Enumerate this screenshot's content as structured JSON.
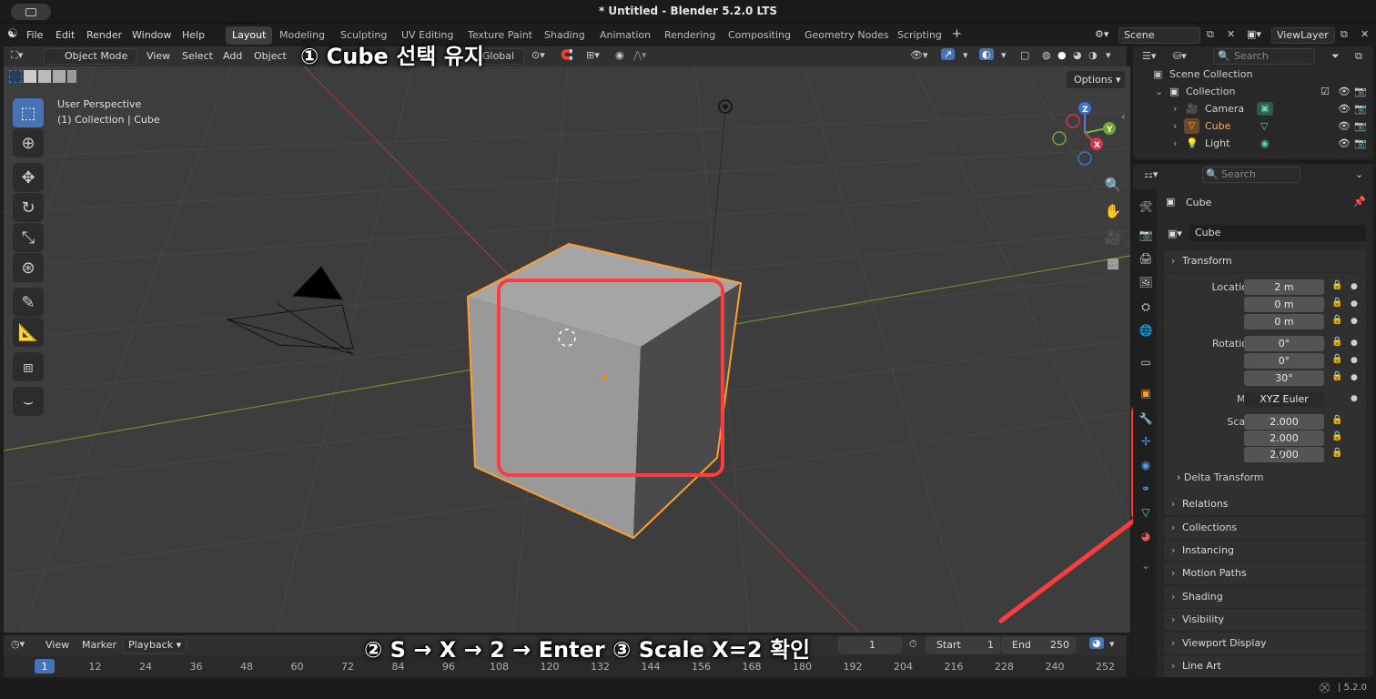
{
  "window": {
    "title": "* Untitled - Blender 5.2.0 LTS"
  },
  "menu": [
    "File",
    "Edit",
    "Render",
    "Window",
    "Help"
  ],
  "workspaces": [
    {
      "label": "Layout",
      "active": true
    },
    {
      "label": "Modeling"
    },
    {
      "label": "Sculpting"
    },
    {
      "label": "UV Editing"
    },
    {
      "label": "Texture Paint"
    },
    {
      "label": "Shading"
    },
    {
      "label": "Animation"
    },
    {
      "label": "Rendering"
    },
    {
      "label": "Compositing"
    },
    {
      "label": "Geometry Nodes"
    },
    {
      "label": "Scripting"
    }
  ],
  "scene": {
    "name": "Scene",
    "view_layer": "ViewLayer"
  },
  "viewport": {
    "mode": "Object Mode",
    "menus": [
      "View",
      "Select",
      "Add",
      "Object"
    ],
    "transform_orientation": "Global",
    "options_label": "Options",
    "perspective_label": "User Perspective",
    "context_label": "(1) Collection | Cube"
  },
  "gizmo": {
    "x": "X",
    "y": "Y",
    "z": "Z"
  },
  "timeline": {
    "menus": [
      "View",
      "Marker"
    ],
    "playback": "Playback",
    "current_frame": "1",
    "start_label": "Start",
    "start": "1",
    "end_label": "End",
    "end": "250",
    "ticks": [
      "1",
      "12",
      "24",
      "36",
      "48",
      "60",
      "72",
      "84",
      "96",
      "108",
      "120",
      "132",
      "144",
      "156",
      "168",
      "180",
      "192",
      "204",
      "216",
      "228",
      "240",
      "252"
    ]
  },
  "outliner": {
    "search_placeholder": "Search",
    "scene_collection": "Scene Collection",
    "collection": "Collection",
    "items": [
      "Camera",
      "Cube",
      "Light"
    ]
  },
  "properties": {
    "search_placeholder": "Search",
    "object_name": "Cube",
    "datablock": "Cube",
    "transform_title": "Transform",
    "location": {
      "label": "Location X",
      "x": "2 m",
      "y": "0 m",
      "z": "0 m"
    },
    "rotation": {
      "label": "Rotation X",
      "x": "0°",
      "y": "0°",
      "z": "30°"
    },
    "mode_label": "Mode",
    "mode_value": "XYZ Euler",
    "scale": {
      "label": "Scale X",
      "x": "2.000",
      "y": "2.000",
      "z": "2.000"
    },
    "axis_y": "Y",
    "axis_z": "Z",
    "delta_transform": "Delta Transform",
    "panels": [
      "Relations",
      "Collections",
      "Instancing",
      "Motion Paths",
      "Shading",
      "Visibility",
      "Viewport Display",
      "Line Art"
    ]
  },
  "status": {
    "version": "5.2.0"
  },
  "annotations": {
    "step1": "① Cube 선택 유지",
    "step2": "② S → X → 2 → Enter  ③ Scale X=2 확인"
  },
  "colors": {
    "accent": "#4772b3",
    "annotation": "#ff3c3c",
    "selected_outline": "#ff9e2a"
  }
}
